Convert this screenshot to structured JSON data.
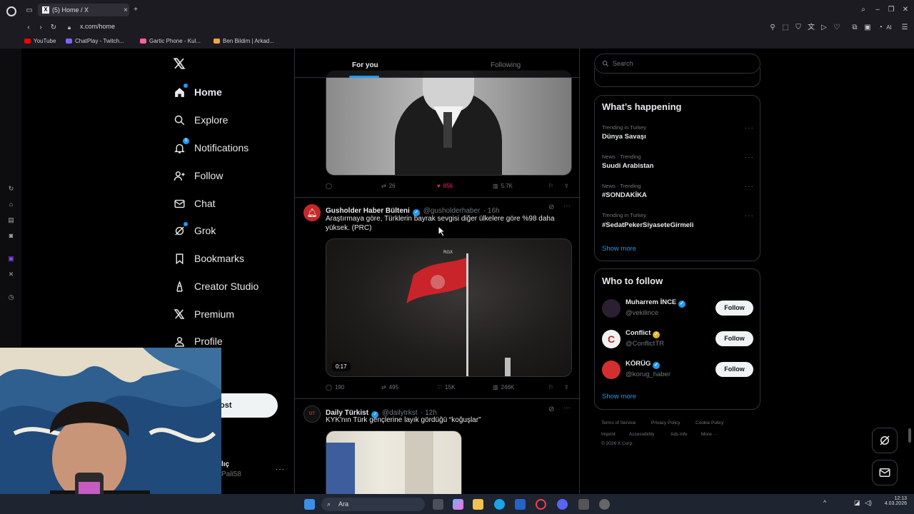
{
  "browser": {
    "tab_title": "(5) Home / X",
    "url": "x.com/home",
    "bookmarks": [
      {
        "label": "YouTube",
        "color": "#ff0000"
      },
      {
        "label": "ChatPlay - Twitch...",
        "color": "#7a66ff"
      },
      {
        "label": "Gartic Phone - Kul...",
        "color": "#ff5ea0"
      },
      {
        "label": "Ben Bildim | Arkad...",
        "color": "#f4a340"
      }
    ]
  },
  "nav": {
    "items": [
      {
        "label": "Home",
        "icon": "home-icon"
      },
      {
        "label": "Explore",
        "icon": "search-icon"
      },
      {
        "label": "Notifications",
        "icon": "bell-icon"
      },
      {
        "label": "Follow",
        "icon": "follow-icon"
      },
      {
        "label": "Chat",
        "icon": "mail-icon"
      },
      {
        "label": "Grok",
        "icon": "grok-icon"
      },
      {
        "label": "Bookmarks",
        "icon": "bookmark-icon"
      },
      {
        "label": "Creator Studio",
        "icon": "creator-icon"
      },
      {
        "label": "Premium",
        "icon": "x-icon"
      },
      {
        "label": "Profile",
        "icon": "profile-icon"
      }
    ],
    "notification_badge": "5",
    "post_button_partial": "ost",
    "account_name_partial": "lıç",
    "account_handle_partial": "Pali58"
  },
  "feed": {
    "tabs": [
      "For you",
      "Following"
    ],
    "tweets": [
      {
        "actions": {
          "reply": "",
          "retweet": "26",
          "like": "856",
          "views": "5.7K"
        }
      },
      {
        "name": "Gusholder Haber Bülteni",
        "handle": "@gusholderhaber",
        "time": "· 16h",
        "text": "Araştırmaya göre, Türklerin bayrak sevgisi diğer ülkelere göre %98 daha yüksek. (PRC)",
        "video_duration": "0:17",
        "watermark": "RGX",
        "actions": {
          "reply": "190",
          "retweet": "495",
          "like": "15K",
          "views": "246K"
        }
      },
      {
        "name": "Daily Türkist",
        "handle": "@dailytrkst",
        "time": "· 12h",
        "text": "KYK'nın Türk gençlerine layık gördüğü “koğuşlar”"
      }
    ]
  },
  "sidebar": {
    "search_placeholder": "Search",
    "whats_happening_title": "What’s happening",
    "trends": [
      {
        "meta": "Trending in Turkey",
        "name": "Dünya Savaşı"
      },
      {
        "meta": "News · Trending",
        "name": "Suudi Arabistan"
      },
      {
        "meta": "News · Trending",
        "name": "#SONDAKİKA"
      },
      {
        "meta": "Trending in Turkey",
        "name": "#SedatPekerSiyaseteGirmeli"
      }
    ],
    "show_more": "Show more",
    "who_to_follow_title": "Who to follow",
    "suggestions": [
      {
        "name": "Muharrem İNCE",
        "handle": "@vekilince",
        "badge": "blue",
        "button": "Follow"
      },
      {
        "name": "Conflict",
        "handle": "@ConflictTR",
        "badge": "gold",
        "button": "Follow"
      },
      {
        "name": "KÖRÜG",
        "handle": "@korug_haber",
        "badge": "blue",
        "button": "Follow"
      }
    ],
    "footer": [
      "Terms of Service",
      "Privacy Policy",
      "Cookie Policy",
      "Imprint",
      "Accessibility",
      "Ads info",
      "More ···",
      "© 2026 X Corp."
    ]
  },
  "taskbar": {
    "search_label": "Ara",
    "clock_time": "12:13",
    "clock_date": "4.03.2026"
  }
}
